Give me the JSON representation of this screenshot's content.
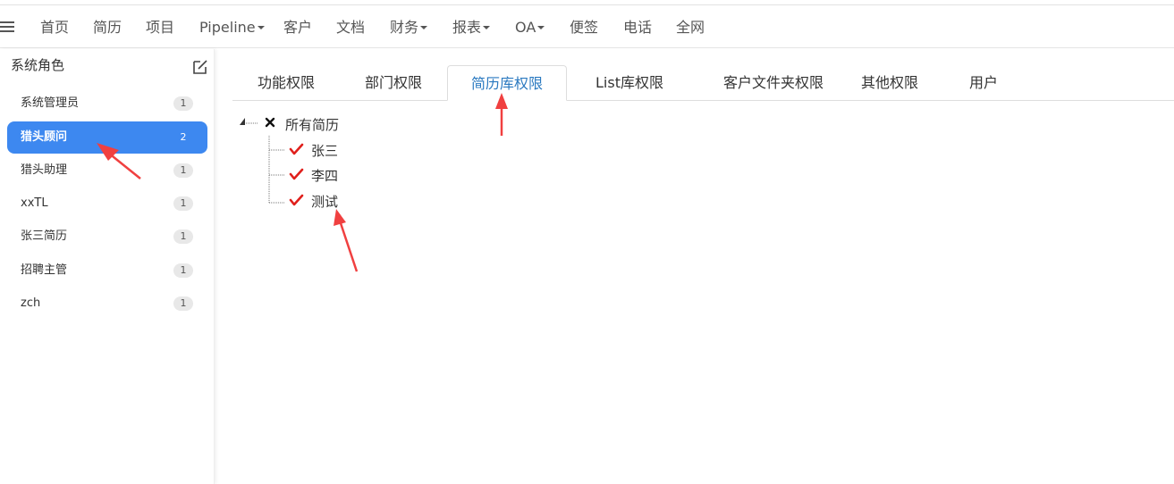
{
  "nav": {
    "items": [
      {
        "label": "首页",
        "dropdown": false
      },
      {
        "label": "简历",
        "dropdown": false
      },
      {
        "label": "项目",
        "dropdown": false
      },
      {
        "label": "Pipeline",
        "dropdown": true
      },
      {
        "label": "客户",
        "dropdown": false
      },
      {
        "label": "文档",
        "dropdown": false
      },
      {
        "label": "财务",
        "dropdown": true
      },
      {
        "label": "报表",
        "dropdown": true
      },
      {
        "label": "OA",
        "dropdown": true
      },
      {
        "label": "便签",
        "dropdown": false
      },
      {
        "label": "电话",
        "dropdown": false
      },
      {
        "label": "全网",
        "dropdown": false
      }
    ]
  },
  "sidebar": {
    "title": "系统角色",
    "roles": [
      {
        "name": "系统管理员",
        "count": "1"
      },
      {
        "name": "猎头顾问",
        "count": "2",
        "active": true
      },
      {
        "name": "猎头助理",
        "count": "1"
      },
      {
        "name": "xxTL",
        "count": "1"
      },
      {
        "name": "张三简历",
        "count": "1"
      },
      {
        "name": "招聘主管",
        "count": "1"
      },
      {
        "name": "zch",
        "count": "1"
      }
    ]
  },
  "tabs": [
    {
      "label": "功能权限"
    },
    {
      "label": "部门权限"
    },
    {
      "label": "简历库权限",
      "active": true
    },
    {
      "label": "List库权限"
    },
    {
      "label": "客户文件夹权限"
    },
    {
      "label": "其他权限"
    },
    {
      "label": "用户"
    }
  ],
  "tree": {
    "root": "所有简历",
    "children": [
      "张三",
      "李四",
      "测试"
    ]
  },
  "colors": {
    "accent": "#3d88f0",
    "tab_active": "#2a79c0",
    "check": "#e0201c",
    "arrow": "#f04040"
  }
}
